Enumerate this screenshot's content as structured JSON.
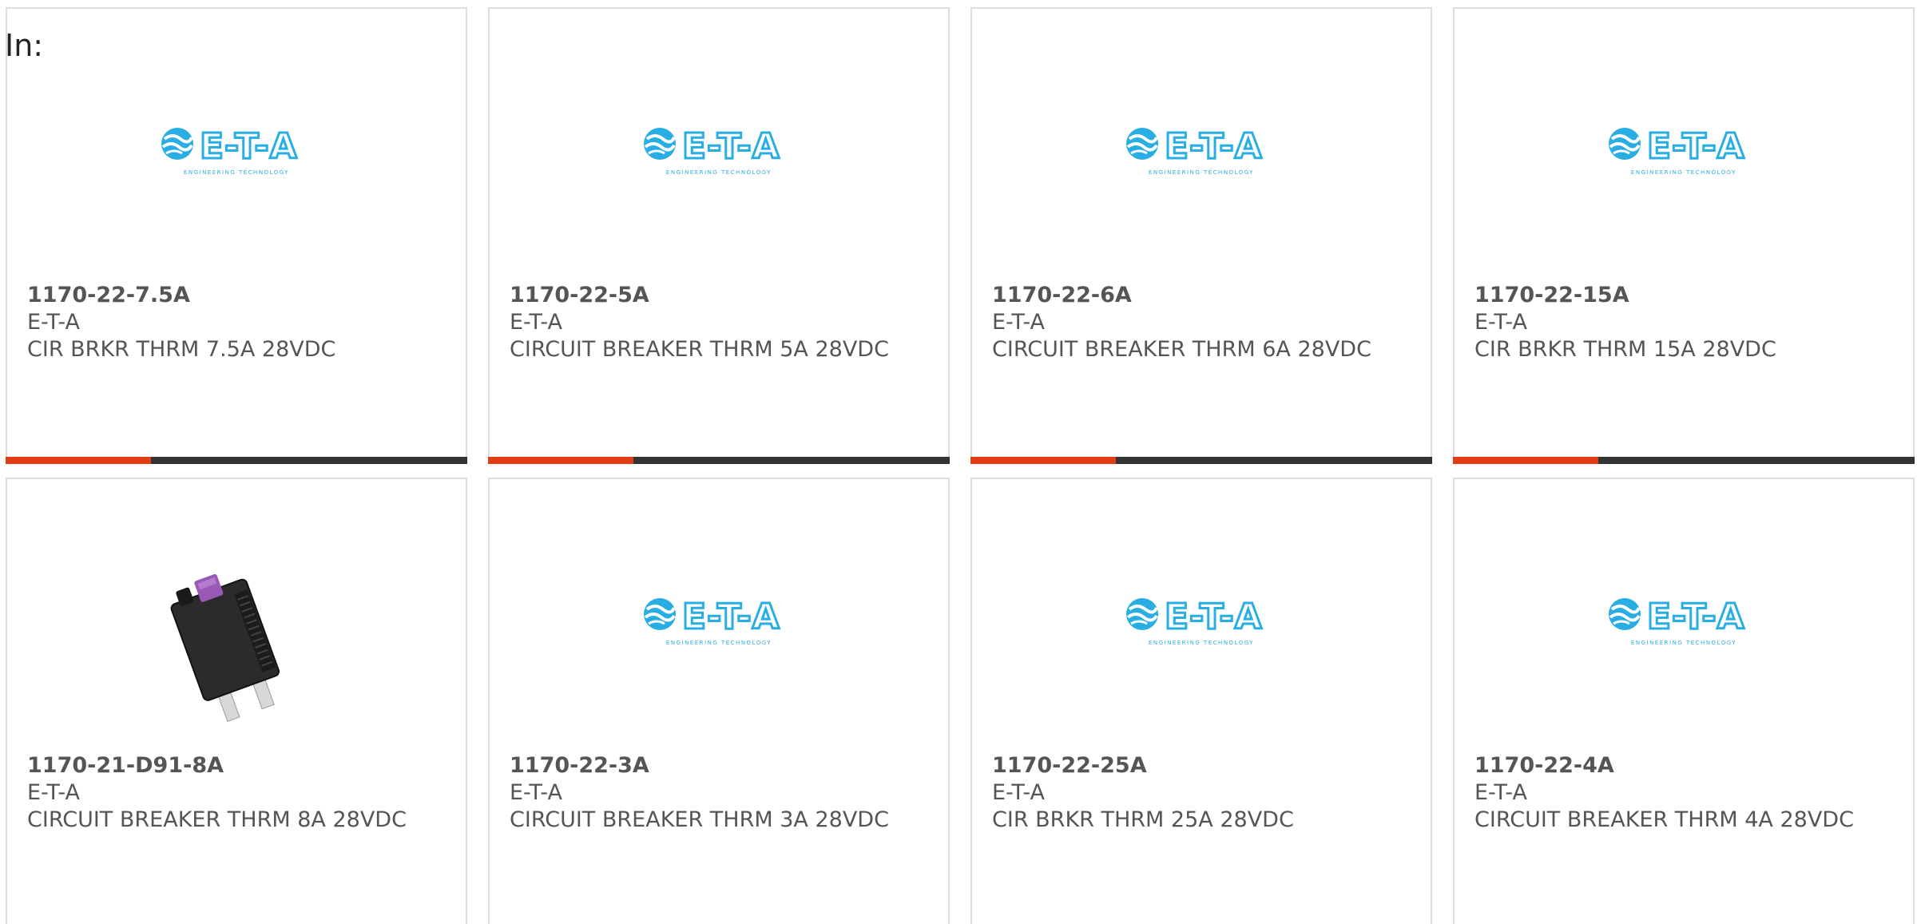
{
  "filter_label": "In:",
  "colors": {
    "accent": "#e23a12",
    "bar_track": "#333333",
    "logo_blue": "#29aee3",
    "text": "#555555",
    "card_border": "#dddddd"
  },
  "logo_text": "E-T-A",
  "logo_subtext": "ENGINEERING TECHNOLOGY",
  "cards": [
    {
      "part_number": "1170-22-7.5A",
      "manufacturer": "E-T-A",
      "description": "CIR BRKR THRM 7.5A 28VDC",
      "image": "eta-logo-icon",
      "progress": 0.315
    },
    {
      "part_number": "1170-22-5A",
      "manufacturer": "E-T-A",
      "description": "CIRCUIT BREAKER THRM 5A 28VDC",
      "image": "eta-logo-icon",
      "progress": 0.315
    },
    {
      "part_number": "1170-22-6A",
      "manufacturer": "E-T-A",
      "description": "CIRCUIT BREAKER THRM 6A 28VDC",
      "image": "eta-logo-icon",
      "progress": 0.315
    },
    {
      "part_number": "1170-22-15A",
      "manufacturer": "E-T-A",
      "description": "CIR BRKR THRM 15A 28VDC",
      "image": "eta-logo-icon",
      "progress": 0.315
    },
    {
      "part_number": "1170-21-D91-8A",
      "manufacturer": "E-T-A",
      "description": "CIRCUIT BREAKER THRM 8A 28VDC",
      "image": "circuit-breaker-icon"
    },
    {
      "part_number": "1170-22-3A",
      "manufacturer": "E-T-A",
      "description": "CIRCUIT BREAKER THRM 3A 28VDC",
      "image": "eta-logo-icon"
    },
    {
      "part_number": "1170-22-25A",
      "manufacturer": "E-T-A",
      "description": "CIR BRKR THRM 25A 28VDC",
      "image": "eta-logo-icon"
    },
    {
      "part_number": "1170-22-4A",
      "manufacturer": "E-T-A",
      "description": "CIRCUIT BREAKER THRM 4A 28VDC",
      "image": "eta-logo-icon"
    }
  ]
}
